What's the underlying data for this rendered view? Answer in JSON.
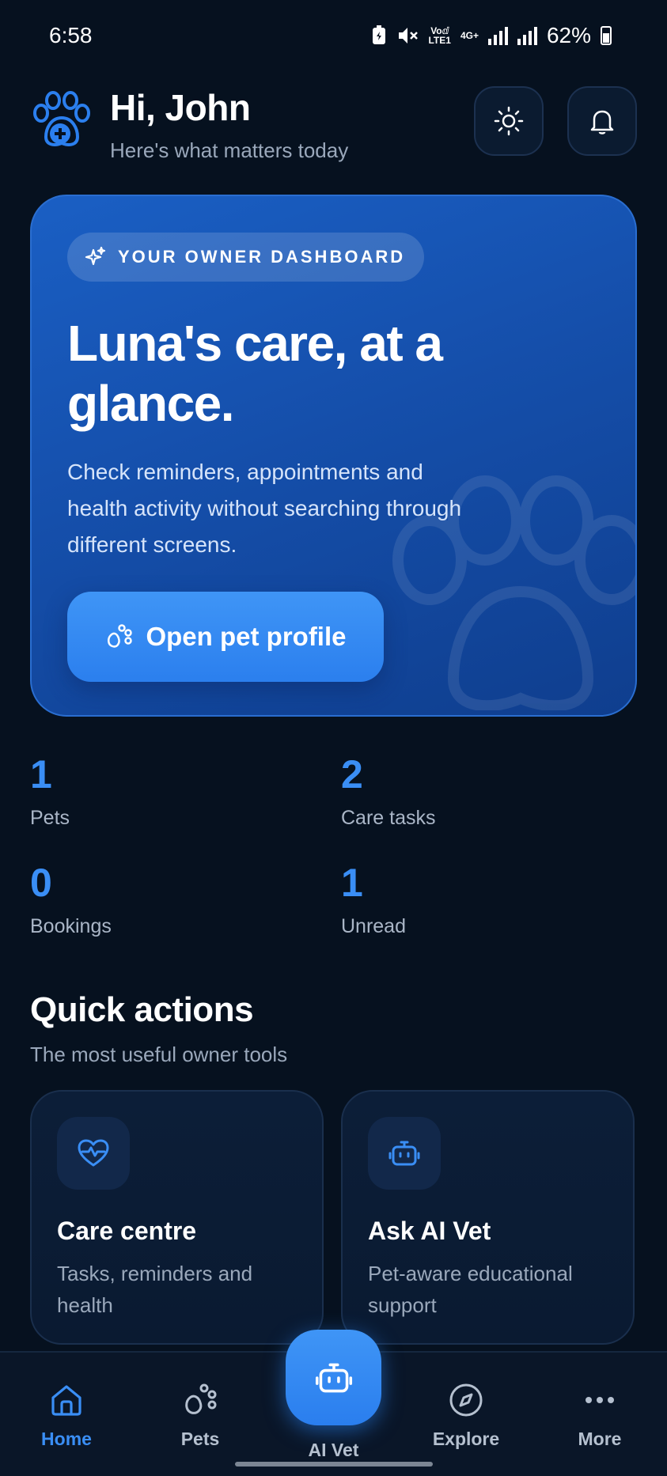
{
  "status_bar": {
    "time": "6:58",
    "volte": "Voⅆ",
    "lte": "LTE1",
    "network": "4G+",
    "battery": "62%"
  },
  "header": {
    "greeting": "Hi, John",
    "subtitle": "Here's what matters today"
  },
  "hero": {
    "pill_label": "YOUR OWNER DASHBOARD",
    "title": "Luna's care, at a glance.",
    "description": "Check reminders, appointments and health activity without searching through different screens.",
    "button_label": "Open pet profile"
  },
  "stats": [
    {
      "value": "1",
      "label": "Pets"
    },
    {
      "value": "2",
      "label": "Care tasks"
    },
    {
      "value": "0",
      "label": "Bookings"
    },
    {
      "value": "1",
      "label": "Unread"
    }
  ],
  "quick_actions": {
    "title": "Quick actions",
    "subtitle": "The most useful owner tools",
    "cards": [
      {
        "name": "Care centre",
        "description": "Tasks, reminders and health"
      },
      {
        "name": "Ask AI Vet",
        "description": "Pet-aware educational support"
      }
    ]
  },
  "bottom_nav": {
    "items": [
      {
        "label": "Home",
        "icon": "home-icon"
      },
      {
        "label": "Pets",
        "icon": "paw-icon"
      },
      {
        "label": "AI Vet",
        "icon": "robot-icon"
      },
      {
        "label": "Explore",
        "icon": "compass-icon"
      },
      {
        "label": "More",
        "icon": "more-icon"
      }
    ]
  },
  "colors": {
    "background": "#06111f",
    "accent": "#3a8ef5",
    "hero": "#1a5fc4"
  }
}
